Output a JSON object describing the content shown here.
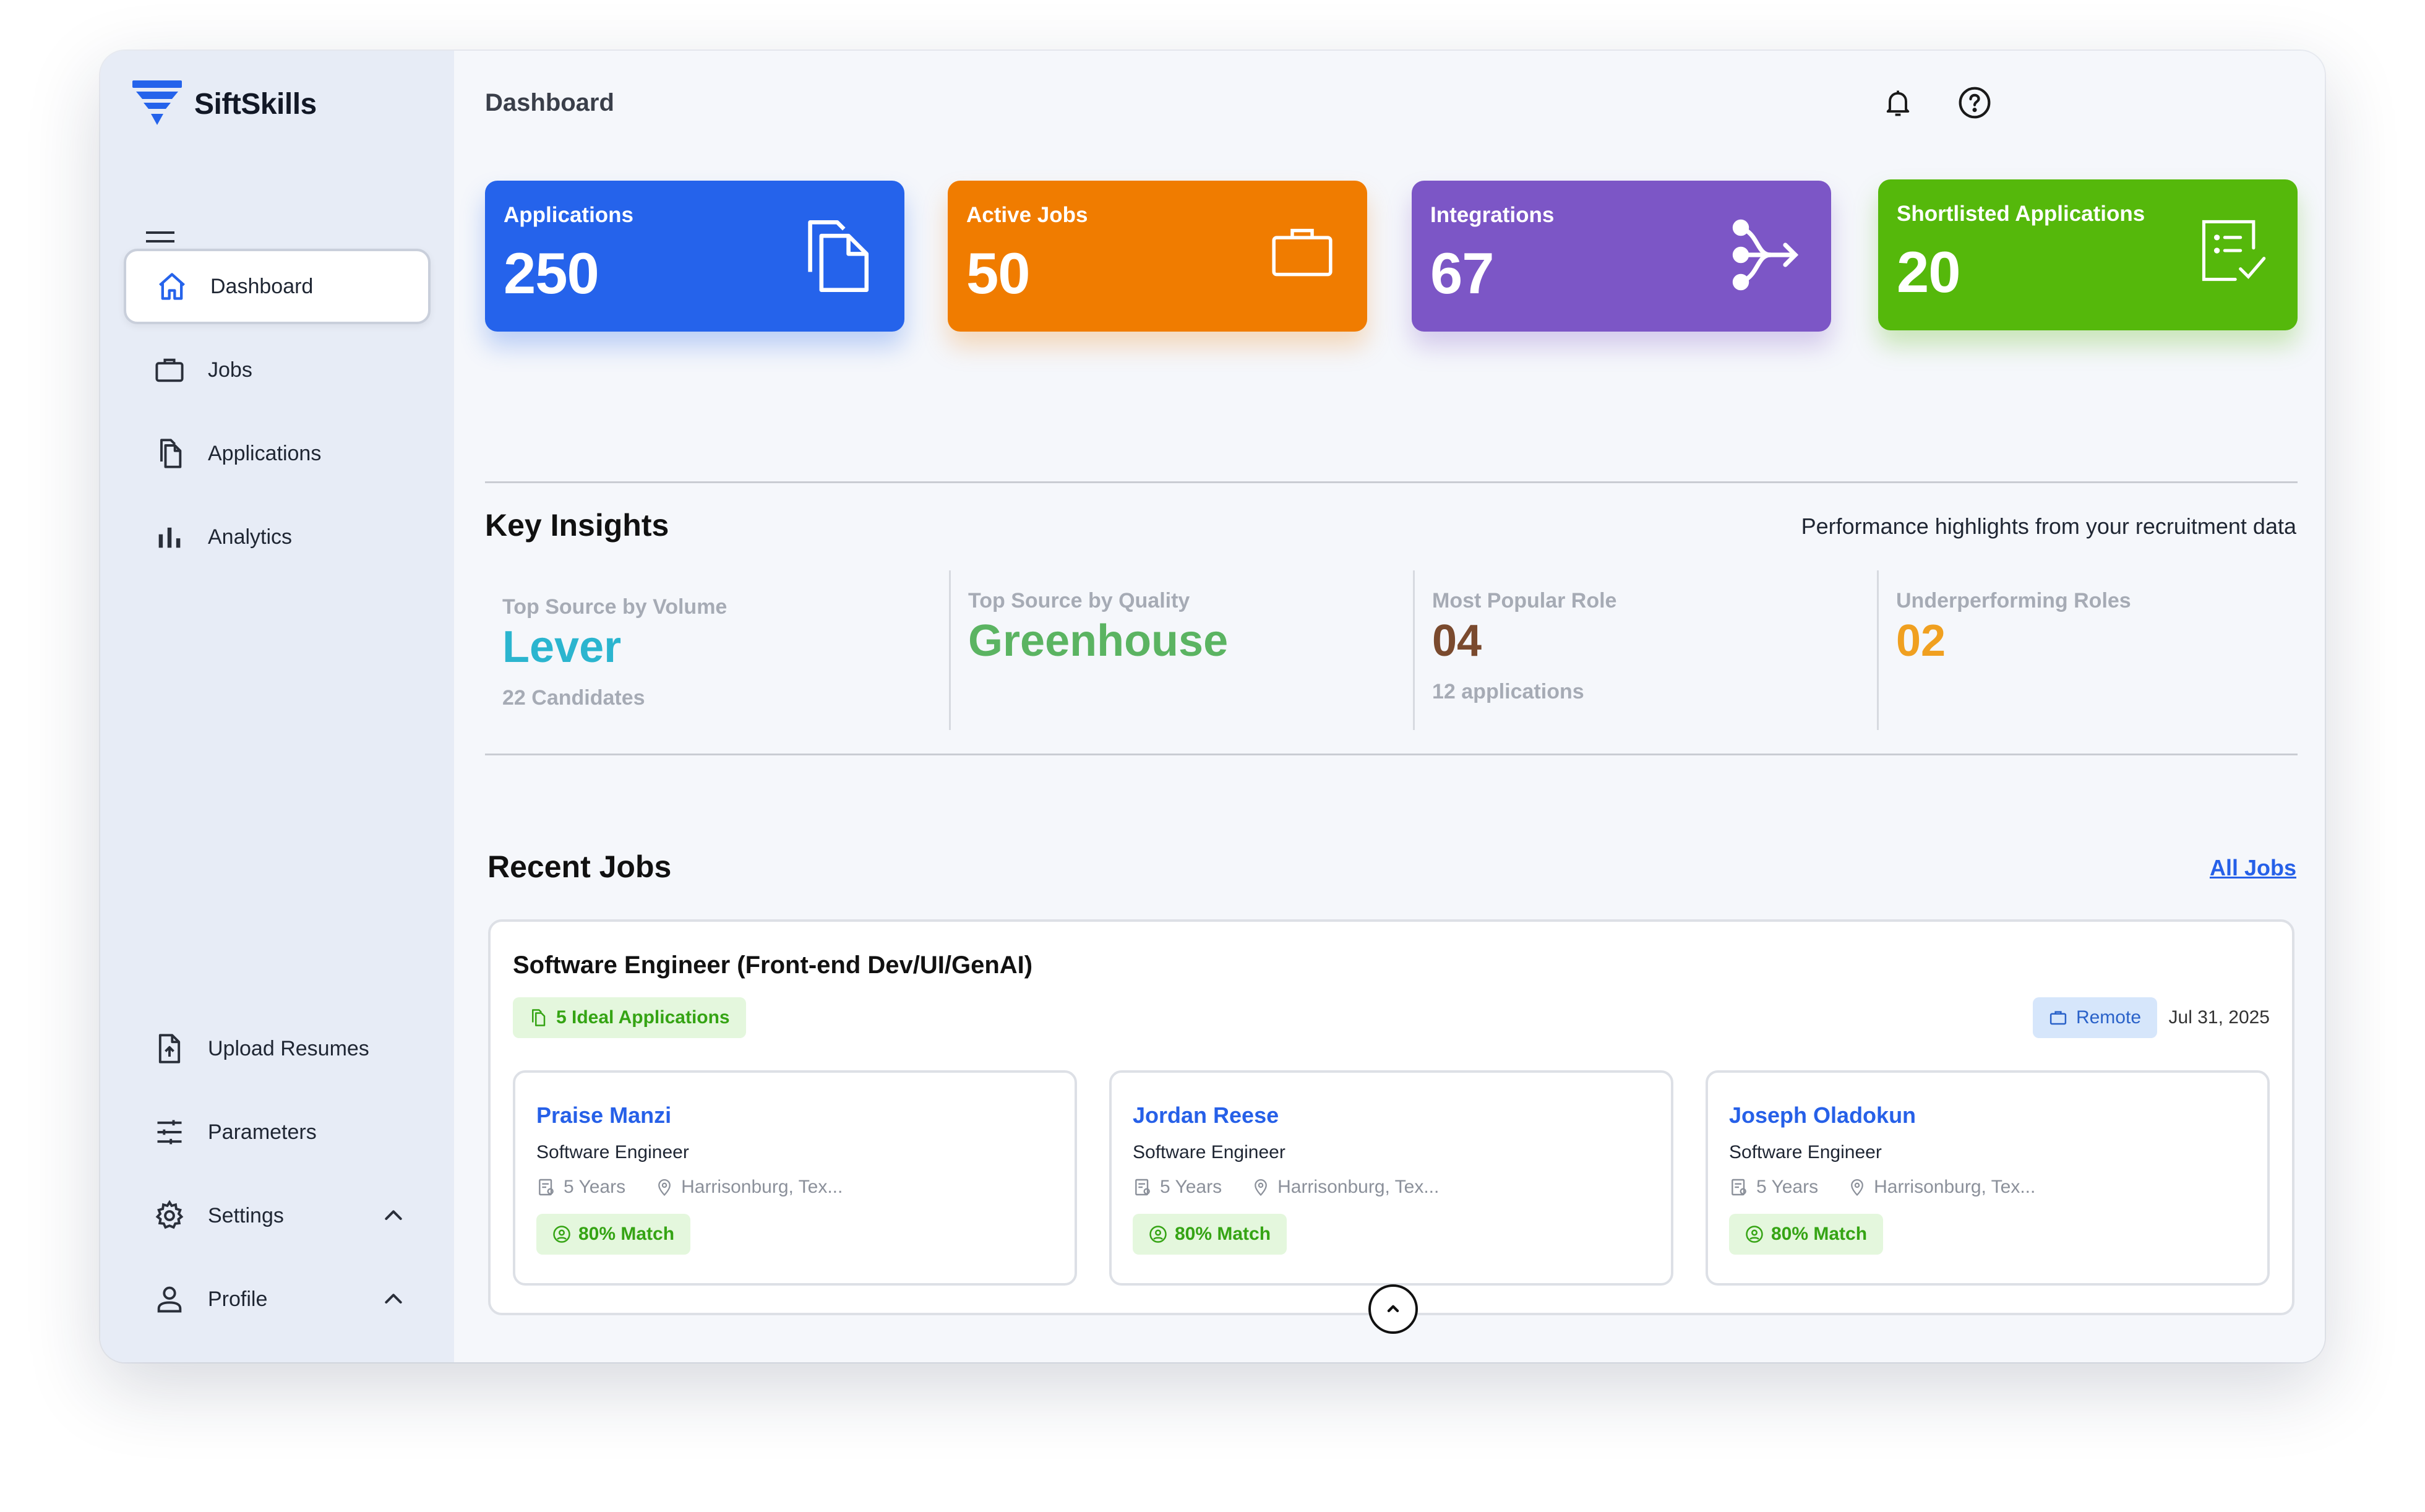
{
  "brand": {
    "name": "SiftSkills",
    "color": "#2563eb"
  },
  "sidebar": {
    "items": [
      {
        "label": "Dashboard",
        "icon": "home-icon",
        "active": true
      },
      {
        "label": "Jobs",
        "icon": "briefcase-icon"
      },
      {
        "label": "Applications",
        "icon": "documents-icon"
      },
      {
        "label": "Analytics",
        "icon": "bar-chart-icon"
      }
    ],
    "bottom_items": [
      {
        "label": "Upload Resumes",
        "icon": "upload-file-icon"
      },
      {
        "label": "Parameters",
        "icon": "sliders-icon"
      },
      {
        "label": "Settings",
        "icon": "gear-icon",
        "chevron": "up"
      },
      {
        "label": "Profile",
        "icon": "user-icon",
        "chevron": "up"
      }
    ]
  },
  "header": {
    "title": "Dashboard"
  },
  "stats": [
    {
      "label": "Applications",
      "value": "250",
      "color": "#2563eb",
      "icon": "documents-icon"
    },
    {
      "label": "Active Jobs",
      "value": "50",
      "color": "#f07c00",
      "icon": "briefcase-icon"
    },
    {
      "label": "Integrations",
      "value": "67",
      "color": "#7c56c6",
      "icon": "merge-arrow-icon"
    },
    {
      "label": "Shortlisted Applications",
      "value": "20",
      "color": "#55b80b",
      "icon": "checklist-icon"
    }
  ],
  "insights": {
    "title": "Key Insights",
    "subtitle": "Performance highlights from your recruitment data",
    "items": [
      {
        "label": "Top Source by Volume",
        "value": "Lever",
        "sub": "22 Candidates",
        "color": "#2bb5cf"
      },
      {
        "label": "Top Source by Quality",
        "value": "Greenhouse",
        "sub": "",
        "color": "#5bb462"
      },
      {
        "label": "Most Popular Role",
        "value": "04",
        "sub": "12 applications",
        "color": "#7a4a2e"
      },
      {
        "label": "Underperforming Roles",
        "value": "02",
        "sub": "",
        "color": "#f0a020"
      }
    ]
  },
  "recent_jobs": {
    "title": "Recent Jobs",
    "all_link": "All Jobs",
    "job": {
      "title": "Software Engineer (Front-end Dev/UI/GenAI)",
      "ideal": "5 Ideal Applications",
      "location_type": "Remote",
      "date": "Jul 31, 2025",
      "candidates": [
        {
          "name": "Praise Manzi",
          "role": "Software Engineer",
          "experience": "5 Years",
          "location": "Harrisonburg, Tex...",
          "match": "80% Match"
        },
        {
          "name": "Jordan Reese",
          "role": "Software Engineer",
          "experience": "5 Years",
          "location": "Harrisonburg, Tex...",
          "match": "80% Match"
        },
        {
          "name": "Joseph Oladokun",
          "role": "Software Engineer",
          "experience": "5 Years",
          "location": "Harrisonburg, Tex...",
          "match": "80% Match"
        }
      ]
    }
  }
}
